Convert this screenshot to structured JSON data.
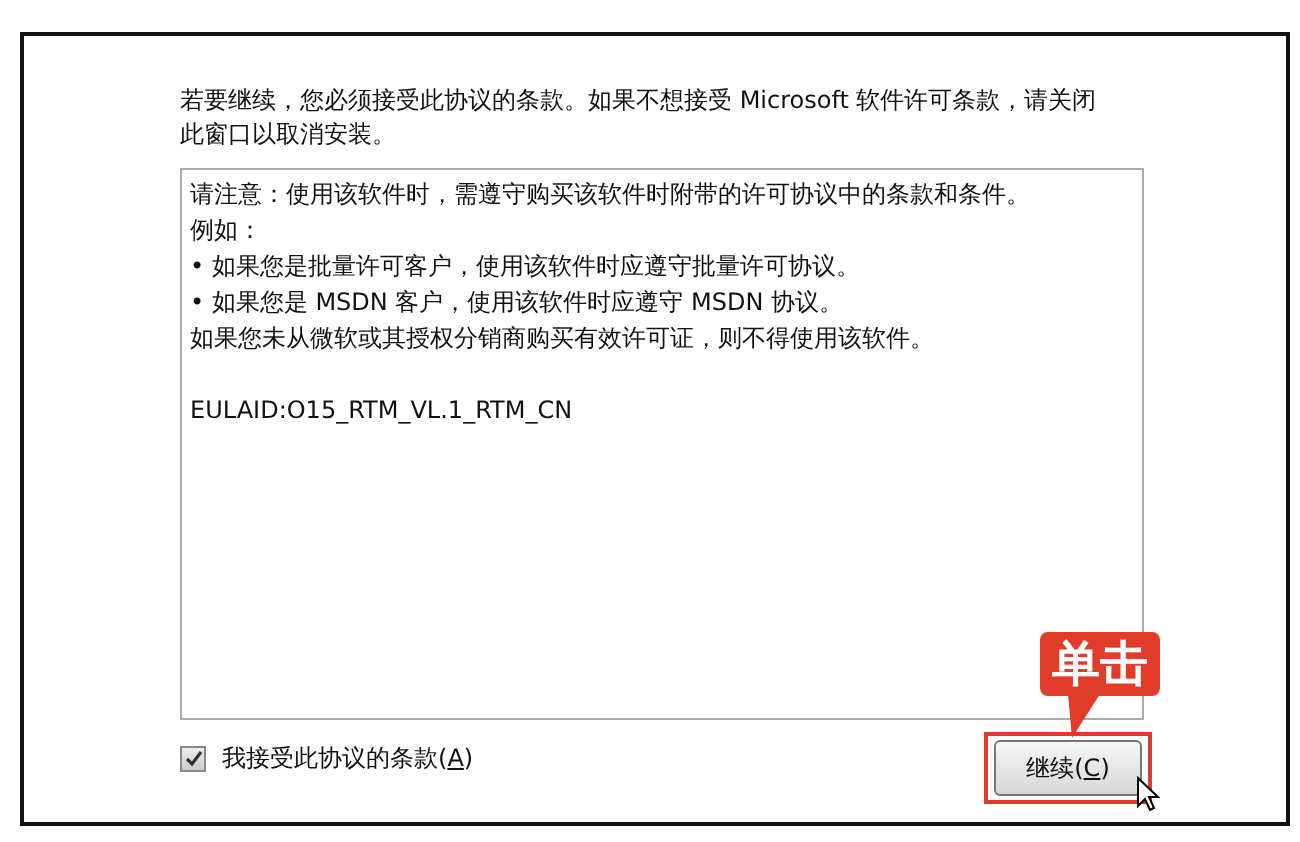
{
  "intro": "若要继续，您必须接受此协议的条款。如果不想接受 Microsoft 软件许可条款，请关闭此窗口以取消安装。",
  "license_lines": [
    {
      "kind": "line",
      "text": "请注意：使用该软件时，需遵守购买该软件时附带的许可协议中的条款和条件。"
    },
    {
      "kind": "line",
      "text": "例如："
    },
    {
      "kind": "line",
      "text": "• 如果您是批量许可客户，使用该软件时应遵守批量许可协议。"
    },
    {
      "kind": "line",
      "text": "• 如果您是 MSDN 客户，使用该软件时应遵守 MSDN 协议。"
    },
    {
      "kind": "line",
      "text": "如果您未从微软或其授权分销商购买有效许可证，则不得使用该软件。"
    },
    {
      "kind": "spaced",
      "text": "EULAID:O15_RTM_VL.1_RTM_CN"
    }
  ],
  "accept_checkbox": {
    "label_before": "我接受此协议的条款(",
    "access_key": "A",
    "label_after": ")",
    "checked": true
  },
  "continue_button": {
    "label_before": "继续(",
    "access_key": "C",
    "label_after": ")"
  },
  "callout": {
    "text": "单击"
  }
}
